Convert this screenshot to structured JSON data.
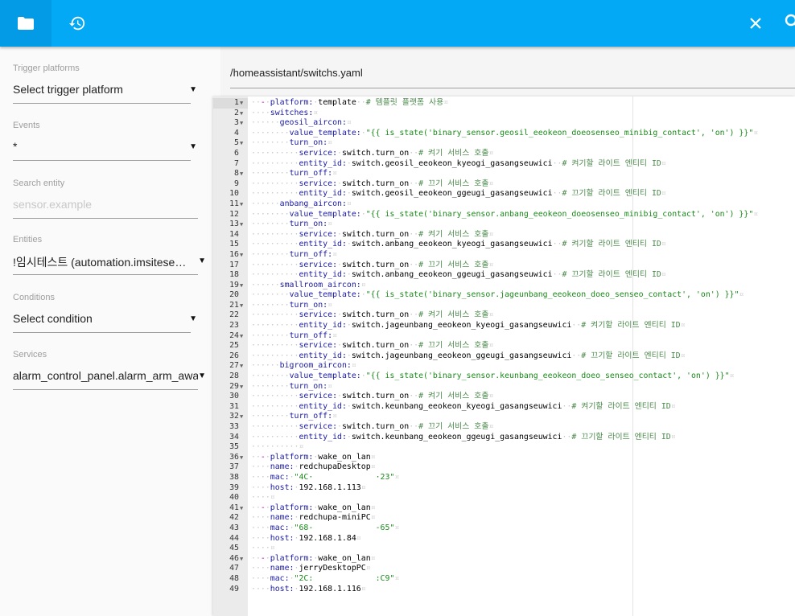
{
  "header": {
    "tabs": [
      {
        "name": "files",
        "icon": "folder-icon",
        "active": true
      },
      {
        "name": "history",
        "icon": "history-icon",
        "active": false
      }
    ],
    "actions": [
      {
        "name": "close",
        "icon": "close-icon"
      },
      {
        "name": "search",
        "icon": "search-icon"
      }
    ],
    "color": "#03a9f4",
    "active_tab_color": "#039be5"
  },
  "sidebar": {
    "fields": [
      {
        "label": "Trigger platforms",
        "value": "Select trigger platform",
        "type": "select"
      },
      {
        "label": "Events",
        "value": "*",
        "type": "select"
      },
      {
        "label": "Search entity",
        "placeholder": "sensor.example",
        "type": "input"
      },
      {
        "label": "Entities",
        "value": "!임시테스트 (automation.imsiteseuteu)",
        "type": "select"
      },
      {
        "label": "Conditions",
        "value": "Select condition",
        "type": "select"
      },
      {
        "label": "Services",
        "value": "alarm_control_panel.alarm_arm_away",
        "type": "select"
      }
    ]
  },
  "main": {
    "file_path": "/homeassistant/switchs.yaml"
  },
  "editor": {
    "active_line": 1,
    "colors": {
      "key": "#1a1aa6",
      "string": "#1a8a1a",
      "comment": "#4c8a4c",
      "dash": "#b000b0"
    },
    "lines": [
      {
        "n": 1,
        "fold": true,
        "t": [
          [
            "ws",
            "  "
          ],
          [
            "dash",
            "-"
          ],
          [
            "ws",
            " "
          ],
          [
            "key",
            "platform:"
          ],
          [
            "ws",
            " "
          ],
          [
            "plain",
            "template"
          ],
          [
            "ws",
            "  "
          ],
          [
            "com",
            "# 템플릿 플랫폼 사용"
          ]
        ]
      },
      {
        "n": 2,
        "fold": true,
        "t": [
          [
            "ws",
            "    "
          ],
          [
            "key",
            "switches:"
          ]
        ]
      },
      {
        "n": 3,
        "fold": true,
        "t": [
          [
            "ws",
            "      "
          ],
          [
            "key",
            "geosil_aircon:"
          ]
        ]
      },
      {
        "n": 4,
        "fold": false,
        "t": [
          [
            "ws",
            "        "
          ],
          [
            "key",
            "value_template:"
          ],
          [
            "ws",
            " "
          ],
          [
            "str",
            "\"{{ is_state('binary_sensor.geosil_eeokeon_doeosenseo_minibig_contact', 'on') }}\""
          ]
        ]
      },
      {
        "n": 5,
        "fold": true,
        "t": [
          [
            "ws",
            "        "
          ],
          [
            "key",
            "turn_on:"
          ]
        ]
      },
      {
        "n": 6,
        "fold": false,
        "t": [
          [
            "ws",
            "          "
          ],
          [
            "key",
            "service:"
          ],
          [
            "ws",
            " "
          ],
          [
            "plain",
            "switch.turn_on"
          ],
          [
            "ws",
            "  "
          ],
          [
            "com",
            "# 켜기 서비스 호출"
          ]
        ]
      },
      {
        "n": 7,
        "fold": false,
        "t": [
          [
            "ws",
            "          "
          ],
          [
            "key",
            "entity_id:"
          ],
          [
            "ws",
            " "
          ],
          [
            "plain",
            "switch.geosil_eeokeon_kyeogi_gasangseuwici"
          ],
          [
            "ws",
            "  "
          ],
          [
            "com",
            "# 켜기할 라이트 엔티티 ID"
          ]
        ]
      },
      {
        "n": 8,
        "fold": true,
        "t": [
          [
            "ws",
            "        "
          ],
          [
            "key",
            "turn_off:"
          ]
        ]
      },
      {
        "n": 9,
        "fold": false,
        "t": [
          [
            "ws",
            "          "
          ],
          [
            "key",
            "service:"
          ],
          [
            "ws",
            " "
          ],
          [
            "plain",
            "switch.turn_on"
          ],
          [
            "ws",
            "  "
          ],
          [
            "com",
            "# 끄기 서비스 호출"
          ]
        ]
      },
      {
        "n": 10,
        "fold": false,
        "t": [
          [
            "ws",
            "          "
          ],
          [
            "key",
            "entity_id:"
          ],
          [
            "ws",
            " "
          ],
          [
            "plain",
            "switch.geosil_eeokeon_ggeugi_gasangseuwici"
          ],
          [
            "ws",
            "  "
          ],
          [
            "com",
            "# 끄기할 라이트 엔티티 ID"
          ]
        ]
      },
      {
        "n": 11,
        "fold": true,
        "t": [
          [
            "ws",
            "      "
          ],
          [
            "key",
            "anbang_aircon:"
          ]
        ]
      },
      {
        "n": 12,
        "fold": false,
        "t": [
          [
            "ws",
            "        "
          ],
          [
            "key",
            "value_template:"
          ],
          [
            "ws",
            " "
          ],
          [
            "str",
            "\"{{ is_state('binary_sensor.anbang_eeokeon_doeosenseo_minibig_contact', 'on') }}\""
          ]
        ]
      },
      {
        "n": 13,
        "fold": true,
        "t": [
          [
            "ws",
            "        "
          ],
          [
            "key",
            "turn_on:"
          ]
        ]
      },
      {
        "n": 14,
        "fold": false,
        "t": [
          [
            "ws",
            "          "
          ],
          [
            "key",
            "service:"
          ],
          [
            "ws",
            " "
          ],
          [
            "plain",
            "switch.turn_on"
          ],
          [
            "ws",
            "  "
          ],
          [
            "com",
            "# 켜기 서비스 호출"
          ]
        ]
      },
      {
        "n": 15,
        "fold": false,
        "t": [
          [
            "ws",
            "          "
          ],
          [
            "key",
            "entity_id:"
          ],
          [
            "ws",
            " "
          ],
          [
            "plain",
            "switch.anbang_eeokeon_kyeogi_gasangseuwici"
          ],
          [
            "ws",
            "  "
          ],
          [
            "com",
            "# 켜기할 라이트 엔티티 ID"
          ]
        ]
      },
      {
        "n": 16,
        "fold": true,
        "t": [
          [
            "ws",
            "        "
          ],
          [
            "key",
            "turn_off:"
          ]
        ]
      },
      {
        "n": 17,
        "fold": false,
        "t": [
          [
            "ws",
            "          "
          ],
          [
            "key",
            "service:"
          ],
          [
            "ws",
            " "
          ],
          [
            "plain",
            "switch.turn_on"
          ],
          [
            "ws",
            "  "
          ],
          [
            "com",
            "# 끄기 서비스 호출"
          ]
        ]
      },
      {
        "n": 18,
        "fold": false,
        "t": [
          [
            "ws",
            "          "
          ],
          [
            "key",
            "entity_id:"
          ],
          [
            "ws",
            " "
          ],
          [
            "plain",
            "switch.anbang_eeokeon_ggeugi_gasangseuwici"
          ],
          [
            "ws",
            "  "
          ],
          [
            "com",
            "# 끄기할 라이트 엔티티 ID"
          ]
        ]
      },
      {
        "n": 19,
        "fold": true,
        "t": [
          [
            "ws",
            "      "
          ],
          [
            "key",
            "smallroom_aircon:"
          ]
        ]
      },
      {
        "n": 20,
        "fold": false,
        "t": [
          [
            "ws",
            "        "
          ],
          [
            "key",
            "value_template:"
          ],
          [
            "ws",
            " "
          ],
          [
            "str",
            "\"{{ is_state('binary_sensor.jageunbang_eeokeon_doeo_senseo_contact', 'on') }}\""
          ]
        ]
      },
      {
        "n": 21,
        "fold": true,
        "t": [
          [
            "ws",
            "        "
          ],
          [
            "key",
            "turn_on:"
          ]
        ]
      },
      {
        "n": 22,
        "fold": false,
        "t": [
          [
            "ws",
            "          "
          ],
          [
            "key",
            "service:"
          ],
          [
            "ws",
            " "
          ],
          [
            "plain",
            "switch.turn_on"
          ],
          [
            "ws",
            "  "
          ],
          [
            "com",
            "# 켜기 서비스 호출"
          ]
        ]
      },
      {
        "n": 23,
        "fold": false,
        "t": [
          [
            "ws",
            "          "
          ],
          [
            "key",
            "entity_id:"
          ],
          [
            "ws",
            " "
          ],
          [
            "plain",
            "switch.jageunbang_eeokeon_kyeogi_gasangseuwici"
          ],
          [
            "ws",
            "  "
          ],
          [
            "com",
            "# 켜기할 라이트 엔티티 ID"
          ]
        ]
      },
      {
        "n": 24,
        "fold": true,
        "t": [
          [
            "ws",
            "        "
          ],
          [
            "key",
            "turn_off:"
          ]
        ]
      },
      {
        "n": 25,
        "fold": false,
        "t": [
          [
            "ws",
            "          "
          ],
          [
            "key",
            "service:"
          ],
          [
            "ws",
            " "
          ],
          [
            "plain",
            "switch.turn_on"
          ],
          [
            "ws",
            "  "
          ],
          [
            "com",
            "# 끄기 서비스 호출"
          ]
        ]
      },
      {
        "n": 26,
        "fold": false,
        "t": [
          [
            "ws",
            "          "
          ],
          [
            "key",
            "entity_id:"
          ],
          [
            "ws",
            " "
          ],
          [
            "plain",
            "switch.jageunbang_eeokeon_ggeugi_gasangseuwici"
          ],
          [
            "ws",
            "  "
          ],
          [
            "com",
            "# 끄기할 라이트 엔티티 ID"
          ]
        ]
      },
      {
        "n": 27,
        "fold": true,
        "t": [
          [
            "ws",
            "      "
          ],
          [
            "key",
            "bigroom_aircon:"
          ]
        ]
      },
      {
        "n": 28,
        "fold": false,
        "t": [
          [
            "ws",
            "        "
          ],
          [
            "key",
            "value_template:"
          ],
          [
            "ws",
            " "
          ],
          [
            "str",
            "\"{{ is_state('binary_sensor.keunbang_eeokeon_doeo_senseo_contact', 'on') }}\""
          ]
        ]
      },
      {
        "n": 29,
        "fold": true,
        "t": [
          [
            "ws",
            "        "
          ],
          [
            "key",
            "turn_on:"
          ]
        ]
      },
      {
        "n": 30,
        "fold": false,
        "t": [
          [
            "ws",
            "          "
          ],
          [
            "key",
            "service:"
          ],
          [
            "ws",
            " "
          ],
          [
            "plain",
            "switch.turn_on"
          ],
          [
            "ws",
            "  "
          ],
          [
            "com",
            "# 켜기 서비스 호출"
          ]
        ]
      },
      {
        "n": 31,
        "fold": false,
        "t": [
          [
            "ws",
            "          "
          ],
          [
            "key",
            "entity_id:"
          ],
          [
            "ws",
            " "
          ],
          [
            "plain",
            "switch.keunbang_eeokeon_kyeogi_gasangseuwici"
          ],
          [
            "ws",
            "  "
          ],
          [
            "com",
            "# 켜기할 라이트 엔티티 ID"
          ]
        ]
      },
      {
        "n": 32,
        "fold": true,
        "t": [
          [
            "ws",
            "        "
          ],
          [
            "key",
            "turn_off:"
          ]
        ]
      },
      {
        "n": 33,
        "fold": false,
        "t": [
          [
            "ws",
            "          "
          ],
          [
            "key",
            "service:"
          ],
          [
            "ws",
            " "
          ],
          [
            "plain",
            "switch.turn_on"
          ],
          [
            "ws",
            "  "
          ],
          [
            "com",
            "# 끄기 서비스 호출"
          ]
        ]
      },
      {
        "n": 34,
        "fold": false,
        "t": [
          [
            "ws",
            "          "
          ],
          [
            "key",
            "entity_id:"
          ],
          [
            "ws",
            " "
          ],
          [
            "plain",
            "switch.keunbang_eeokeon_ggeugi_gasangseuwici"
          ],
          [
            "ws",
            "  "
          ],
          [
            "com",
            "# 끄기할 라이트 엔티티 ID"
          ]
        ]
      },
      {
        "n": 35,
        "fold": false,
        "t": [
          [
            "ws",
            "          "
          ]
        ]
      },
      {
        "n": 36,
        "fold": true,
        "t": [
          [
            "ws",
            "  "
          ],
          [
            "dash",
            "-"
          ],
          [
            "ws",
            " "
          ],
          [
            "key",
            "platform:"
          ],
          [
            "ws",
            " "
          ],
          [
            "plain",
            "wake_on_lan"
          ]
        ]
      },
      {
        "n": 37,
        "fold": false,
        "t": [
          [
            "ws",
            "    "
          ],
          [
            "key",
            "name:"
          ],
          [
            "ws",
            " "
          ],
          [
            "plain",
            "redchupaDesktop"
          ]
        ]
      },
      {
        "n": 38,
        "fold": false,
        "t": [
          [
            "ws",
            "    "
          ],
          [
            "key",
            "mac:"
          ],
          [
            "ws",
            " "
          ],
          [
            "str",
            "\"4C·             ·23\""
          ]
        ]
      },
      {
        "n": 39,
        "fold": false,
        "t": [
          [
            "ws",
            "    "
          ],
          [
            "key",
            "host:"
          ],
          [
            "ws",
            " "
          ],
          [
            "plain",
            "192.168.1.113"
          ]
        ]
      },
      {
        "n": 40,
        "fold": false,
        "t": [
          [
            "ws",
            "    "
          ]
        ]
      },
      {
        "n": 41,
        "fold": true,
        "t": [
          [
            "ws",
            "  "
          ],
          [
            "dash",
            "-"
          ],
          [
            "ws",
            " "
          ],
          [
            "key",
            "platform:"
          ],
          [
            "ws",
            " "
          ],
          [
            "plain",
            "wake_on_lan"
          ]
        ]
      },
      {
        "n": 42,
        "fold": false,
        "t": [
          [
            "ws",
            "    "
          ],
          [
            "key",
            "name:"
          ],
          [
            "ws",
            " "
          ],
          [
            "plain",
            "redchupa-miniPC"
          ]
        ]
      },
      {
        "n": 43,
        "fold": false,
        "t": [
          [
            "ws",
            "    "
          ],
          [
            "key",
            "mac:"
          ],
          [
            "ws",
            " "
          ],
          [
            "str",
            "\"68-             -65\""
          ]
        ]
      },
      {
        "n": 44,
        "fold": false,
        "t": [
          [
            "ws",
            "    "
          ],
          [
            "key",
            "host:"
          ],
          [
            "ws",
            " "
          ],
          [
            "plain",
            "192.168.1.84"
          ]
        ]
      },
      {
        "n": 45,
        "fold": false,
        "t": [
          [
            "ws",
            "    "
          ]
        ]
      },
      {
        "n": 46,
        "fold": true,
        "t": [
          [
            "ws",
            "  "
          ],
          [
            "dash",
            "-"
          ],
          [
            "ws",
            " "
          ],
          [
            "key",
            "platform:"
          ],
          [
            "ws",
            " "
          ],
          [
            "plain",
            "wake_on_lan"
          ]
        ]
      },
      {
        "n": 47,
        "fold": false,
        "t": [
          [
            "ws",
            "    "
          ],
          [
            "key",
            "name:"
          ],
          [
            "ws",
            " "
          ],
          [
            "plain",
            "jerryDesktopPC"
          ]
        ]
      },
      {
        "n": 48,
        "fold": false,
        "t": [
          [
            "ws",
            "    "
          ],
          [
            "key",
            "mac:"
          ],
          [
            "ws",
            " "
          ],
          [
            "str",
            "\"2C:             :C9\""
          ]
        ]
      },
      {
        "n": 49,
        "fold": false,
        "t": [
          [
            "ws",
            "    "
          ],
          [
            "key",
            "host:"
          ],
          [
            "ws",
            " "
          ],
          [
            "plain",
            "192.168.1.116"
          ]
        ]
      }
    ]
  }
}
